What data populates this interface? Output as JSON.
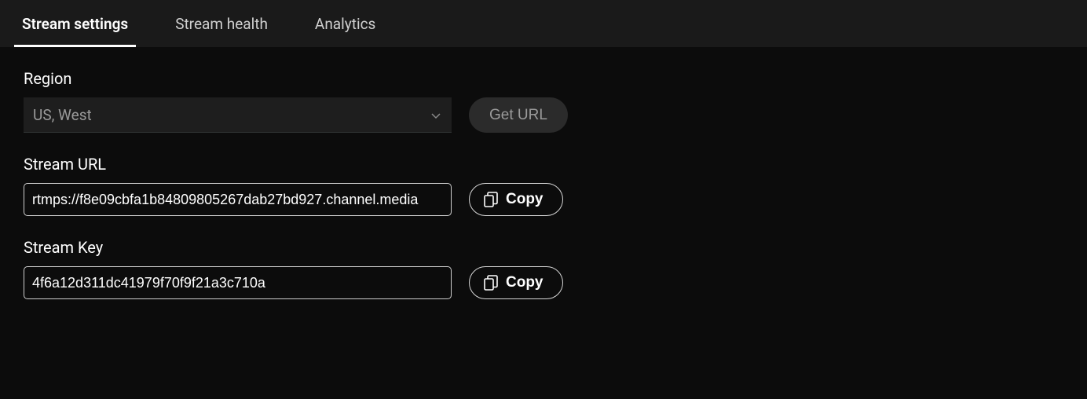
{
  "tabs": {
    "settings": "Stream settings",
    "health": "Stream health",
    "analytics": "Analytics"
  },
  "region": {
    "label": "Region",
    "selected": "US, West",
    "button": "Get URL"
  },
  "stream_url": {
    "label": "Stream URL",
    "value": "rtmps://f8e09cbfa1b84809805267dab27bd927.channel.media",
    "copy": "Copy"
  },
  "stream_key": {
    "label": "Stream Key",
    "value": "4f6a12d311dc41979f70f9f21a3c710a",
    "copy": "Copy"
  }
}
